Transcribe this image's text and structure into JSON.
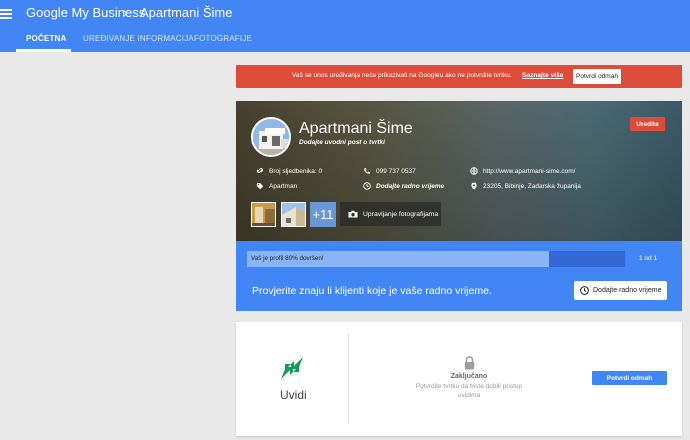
{
  "header": {
    "brand": "Google My Business",
    "chevron": "›",
    "business_title": "Apartmani Šime"
  },
  "tabs": [
    {
      "label": "POČETNA",
      "active": true
    },
    {
      "label": "UREĐIVANJE INFORMACIJA",
      "active": false
    },
    {
      "label": "FOTOGRAFIJE",
      "active": false
    }
  ],
  "banner": {
    "text": "Vaš se unos uređivanja neće prikazivati na Googleu ako ne potvrdite tvrtku.",
    "link": "Saznajte više",
    "button": "Potvrdi odmah",
    "color": "#dd4b39"
  },
  "profile": {
    "name": "Apartmani Šime",
    "subtitle": "Dodajte uvodni post o tvrtki",
    "edit_button": "Uredite",
    "followers": "Broj sljedbenika: 0",
    "phone": "099 737 0537",
    "website": "http://www.apartmani-sime.com/",
    "category": "Apartman",
    "hours": "Dodajte radno vrijeme",
    "address": "23205, Bibinje, Zadarska županija",
    "photos_more": "+11",
    "manage_photos": "Upravljanje fotografijama"
  },
  "progress": {
    "label": "Vaš je profil 80% dovršen!",
    "percent": 80,
    "count": "1 od 1",
    "prompt": "Provjerite znaju li klijenti koje je vaše radno vrijeme.",
    "button": "Dodajte radno vrijeme"
  },
  "insights": {
    "label": "Uvidi",
    "locked_title": "Zaključano",
    "locked_desc": "Potvrdite tvrtku da biste dobili pristup uvidima",
    "button": "Potvrdi odmah"
  },
  "colors": {
    "primary": "#4285f4",
    "danger": "#dd4b39",
    "insights_green": "#0f9d58"
  }
}
